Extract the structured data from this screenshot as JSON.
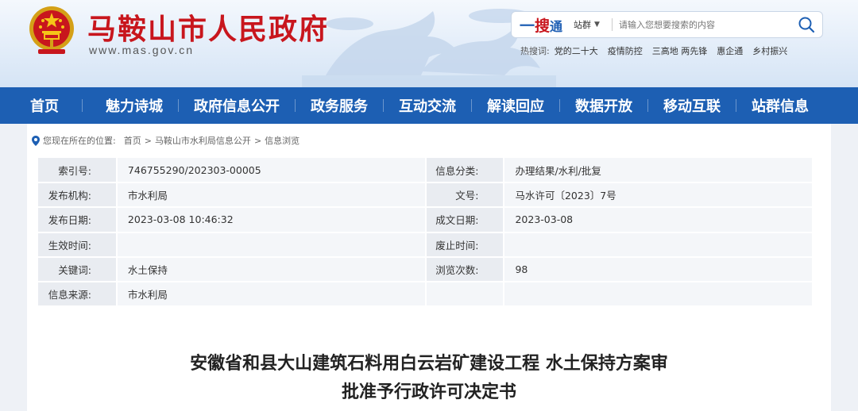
{
  "header": {
    "site_title": "马鞍山市人民政府",
    "site_url": "www.mas.gov.cn",
    "emblem_icon": "national-emblem-icon"
  },
  "search": {
    "logo_yi": "一",
    "logo_sou": "搜",
    "logo_tong": "通",
    "scope": "站群",
    "placeholder": "请输入您想要搜索的内容",
    "button_icon": "search-icon"
  },
  "hotwords": {
    "label": "热搜词:",
    "items": [
      "党的二十大",
      "疫情防控",
      "三高地 两先锋",
      "惠企通",
      "乡村振兴"
    ]
  },
  "nav": {
    "items": [
      "首页",
      "魅力诗城",
      "政府信息公开",
      "政务服务",
      "互动交流",
      "解读回应",
      "数据开放",
      "移动互联",
      "站群信息"
    ]
  },
  "breadcrumb": {
    "prefix": "您现在所在的位置:",
    "items": [
      "首页",
      "马鞍山市水利局信息公开",
      "信息浏览"
    ],
    "separator": ">"
  },
  "info": {
    "rows": [
      {
        "l1": "索引号:",
        "v1": "746755290/202303-00005",
        "l2": "信息分类:",
        "v2": "办理结果/水利/批复"
      },
      {
        "l1": "发布机构:",
        "v1": "市水利局",
        "l2": "文号:",
        "v2": "马水许可〔2023〕7号"
      },
      {
        "l1": "发布日期:",
        "v1": "2023-03-08 10:46:32",
        "l2": "成文日期:",
        "v2": "2023-03-08"
      },
      {
        "l1": "生效时间:",
        "v1": "",
        "l2": "废止时间:",
        "v2": ""
      },
      {
        "l1": "关键词:",
        "v1": "水土保持",
        "l2": "浏览次数:",
        "v2": "98"
      },
      {
        "l1": "信息来源:",
        "v1": "市水利局",
        "l2": "",
        "v2": ""
      }
    ]
  },
  "document": {
    "title_line1": "安徽省和县大山建筑石料用白云岩矿建设工程 水土保持方案审",
    "title_line2": "批准予行政许可决定书"
  },
  "colors": {
    "brand_red": "#c8161d",
    "nav_blue": "#1d5fb3"
  }
}
